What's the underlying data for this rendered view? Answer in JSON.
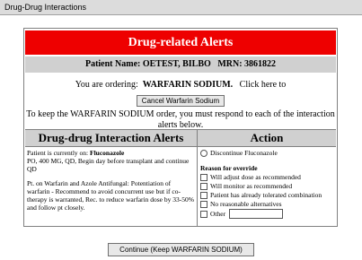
{
  "window": {
    "title": "Drug-Drug Interactions"
  },
  "header": {
    "title": "Drug-related Alerts"
  },
  "patient": {
    "label": "Patient Name:",
    "name": "OETEST, BILBO",
    "mrn_label": "MRN:",
    "mrn": "3861822"
  },
  "ordering": {
    "prefix": "You are ordering:",
    "drug": "WARFARIN SODIUM.",
    "suffix": "Click here to"
  },
  "cancel_button": {
    "label": "Cancel Warfarin Sodium"
  },
  "instruction": "To keep the WARFARIN SODIUM order, you must respond to each of the interaction alerts below.",
  "alerts": {
    "heading": "Drug-drug Interaction Alerts",
    "current_prefix": "Patient is currently on:",
    "current_drug": "Fluconazole",
    "current_detail": "PO, 400 MG, QD, Begin day before transplant and continue QD",
    "note": "Pt. on Warfarin and Azole Antifungal: Potentiation of warfarin - Recommend to avoid concurrent use but if co-therapy is warranted, Rec. to reduce warfarin dose by 33-50% and follow pt closely."
  },
  "action": {
    "heading": "Action",
    "discontinue_label": "Discontinue Fluconazole",
    "reason_heading": "Reason for override",
    "reasons": [
      "Will adjust dose as recommended",
      "Will monitor as recommended",
      "Patient has already tolerated combination",
      "No reasonable alternatives"
    ],
    "other_label": "Other"
  },
  "continue_button": {
    "label": "Continue (Keep WARFARIN SODIUM)"
  }
}
